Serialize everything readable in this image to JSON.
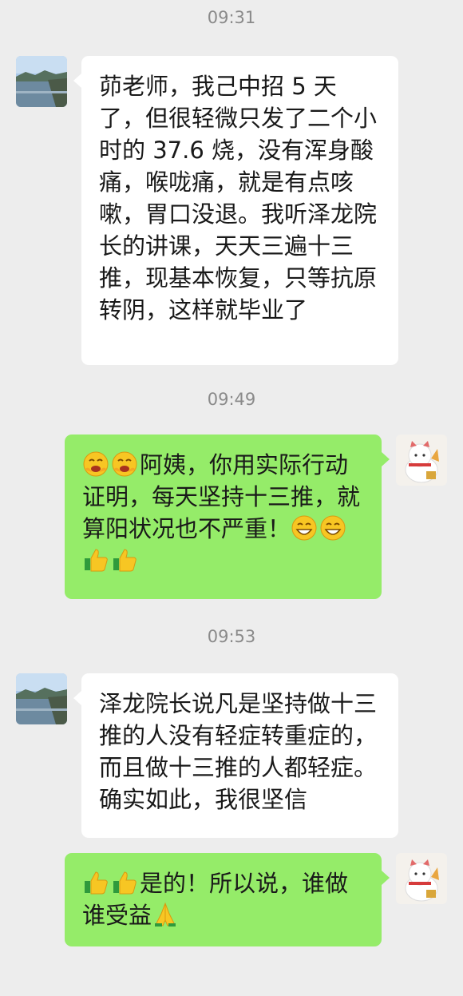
{
  "messages": [
    {
      "time": "09:31"
    },
    {
      "side": "left",
      "text": "茆老师，我己中招 5 天了，但很轻微只发了二个小时的 37.6 烧，没有浑身酸痛，喉咙痛，就是有点咳嗽，胃口没退。我听泽龙院长的讲课，天天三遍十三推，现基本恢复，只等抗原转阴，这样就毕业了"
    },
    {
      "time": "09:49"
    },
    {
      "side": "right",
      "text1": "阿姨，你用实际行动证明，每天坚持十三推，就算阳状况也不严重！",
      "emojis": [
        "laughing-hands-emoji",
        "grin-emoji",
        "thumbs-up-emoji"
      ]
    },
    {
      "time": "09:53"
    },
    {
      "side": "left",
      "text": "泽龙院长说凡是坚持做十三推的人没有轻症转重症的，而且做十三推的人都轻症。确实如此，我很坚信"
    },
    {
      "side": "right",
      "text1": "是的！所以说，谁做谁受益",
      "emojis": [
        "thumbs-up-emoji",
        "pray-emoji"
      ]
    }
  ],
  "colors": {
    "background": "#ededed",
    "left_bubble": "#ffffff",
    "right_bubble": "#95ec69",
    "time_text": "#8a8a8a"
  }
}
